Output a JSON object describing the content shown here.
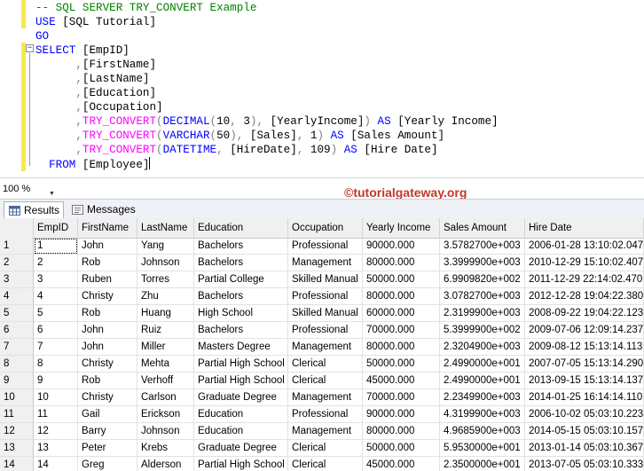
{
  "editor": {
    "lines": [
      [
        {
          "t": "-- SQL SERVER TRY_CONVERT Example",
          "c": "cm"
        }
      ],
      [
        {
          "t": "USE ",
          "c": "kw"
        },
        {
          "t": "[SQL Tutorial]",
          "c": "tx"
        }
      ],
      [
        {
          "t": "GO",
          "c": "kw"
        }
      ],
      [
        {
          "t": "SELECT ",
          "c": "kw"
        },
        {
          "t": "[EmpID]",
          "c": "tx"
        }
      ],
      [
        {
          "t": "      ,",
          "c": "gr"
        },
        {
          "t": "[FirstName]",
          "c": "tx"
        }
      ],
      [
        {
          "t": "      ,",
          "c": "gr"
        },
        {
          "t": "[LastName]",
          "c": "tx"
        }
      ],
      [
        {
          "t": "      ,",
          "c": "gr"
        },
        {
          "t": "[Education]",
          "c": "tx"
        }
      ],
      [
        {
          "t": "      ,",
          "c": "gr"
        },
        {
          "t": "[Occupation]",
          "c": "tx"
        }
      ],
      [
        {
          "t": "      ,",
          "c": "gr"
        },
        {
          "t": "TRY_CONVERT",
          "c": "fn"
        },
        {
          "t": "(",
          "c": "gr"
        },
        {
          "t": "DECIMAL",
          "c": "kw"
        },
        {
          "t": "(",
          "c": "gr"
        },
        {
          "t": "10",
          "c": "tx"
        },
        {
          "t": ", ",
          "c": "gr"
        },
        {
          "t": "3",
          "c": "tx"
        },
        {
          "t": "), ",
          "c": "gr"
        },
        {
          "t": "[YearlyIncome]",
          "c": "tx"
        },
        {
          "t": ") ",
          "c": "gr"
        },
        {
          "t": "AS ",
          "c": "kw"
        },
        {
          "t": "[Yearly Income]",
          "c": "tx"
        }
      ],
      [
        {
          "t": "      ,",
          "c": "gr"
        },
        {
          "t": "TRY_CONVERT",
          "c": "fn"
        },
        {
          "t": "(",
          "c": "gr"
        },
        {
          "t": "VARCHAR",
          "c": "kw"
        },
        {
          "t": "(",
          "c": "gr"
        },
        {
          "t": "50",
          "c": "tx"
        },
        {
          "t": "), ",
          "c": "gr"
        },
        {
          "t": "[Sales]",
          "c": "tx"
        },
        {
          "t": ", ",
          "c": "gr"
        },
        {
          "t": "1",
          "c": "tx"
        },
        {
          "t": ") ",
          "c": "gr"
        },
        {
          "t": "AS ",
          "c": "kw"
        },
        {
          "t": "[Sales Amount]",
          "c": "tx"
        }
      ],
      [
        {
          "t": "      ,",
          "c": "gr"
        },
        {
          "t": "TRY_CONVERT",
          "c": "fn"
        },
        {
          "t": "(",
          "c": "gr"
        },
        {
          "t": "DATETIME",
          "c": "kw"
        },
        {
          "t": ", ",
          "c": "gr"
        },
        {
          "t": "[HireDate]",
          "c": "tx"
        },
        {
          "t": ", ",
          "c": "gr"
        },
        {
          "t": "109",
          "c": "tx"
        },
        {
          "t": ") ",
          "c": "gr"
        },
        {
          "t": "AS ",
          "c": "kw"
        },
        {
          "t": "[Hire Date]",
          "c": "tx"
        }
      ],
      [
        {
          "t": "  FROM ",
          "c": "kw"
        },
        {
          "t": "[Employee]",
          "c": "tx"
        }
      ]
    ]
  },
  "zoom": {
    "value": "100 %"
  },
  "watermark": "©tutorialgateway.org",
  "tabs": [
    {
      "label": "Results",
      "icon": "results-grid-icon",
      "active": true
    },
    {
      "label": "Messages",
      "icon": "messages-icon",
      "active": false
    }
  ],
  "grid": {
    "columns": [
      "EmpID",
      "FirstName",
      "LastName",
      "Education",
      "Occupation",
      "Yearly Income",
      "Sales Amount",
      "Hire Date"
    ],
    "rows": [
      [
        "1",
        "1",
        "John",
        "Yang",
        "Bachelors",
        "Professional",
        "90000.000",
        "3.5782700e+003",
        "2006-01-28 13:10:02.047"
      ],
      [
        "2",
        "2",
        "Rob",
        "Johnson",
        "Bachelors",
        "Management",
        "80000.000",
        "3.3999900e+003",
        "2010-12-29 15:10:02.407"
      ],
      [
        "3",
        "3",
        "Ruben",
        "Torres",
        "Partial College",
        "Skilled Manual",
        "50000.000",
        "6.9909820e+002",
        "2011-12-29 22:14:02.470"
      ],
      [
        "4",
        "4",
        "Christy",
        "Zhu",
        "Bachelors",
        "Professional",
        "80000.000",
        "3.0782700e+003",
        "2012-12-28 19:04:22.380"
      ],
      [
        "5",
        "5",
        "Rob",
        "Huang",
        "High School",
        "Skilled Manual",
        "60000.000",
        "2.3199900e+003",
        "2008-09-22 19:04:22.123"
      ],
      [
        "6",
        "6",
        "John",
        "Ruiz",
        "Bachelors",
        "Professional",
        "70000.000",
        "5.3999900e+002",
        "2009-07-06 12:09:14.237"
      ],
      [
        "7",
        "7",
        "John",
        "Miller",
        "Masters Degree",
        "Management",
        "80000.000",
        "2.3204900e+003",
        "2009-08-12 15:13:14.113"
      ],
      [
        "8",
        "8",
        "Christy",
        "Mehta",
        "Partial High School",
        "Clerical",
        "50000.000",
        "2.4990000e+001",
        "2007-07-05 15:13:14.290"
      ],
      [
        "9",
        "9",
        "Rob",
        "Verhoff",
        "Partial High School",
        "Clerical",
        "45000.000",
        "2.4990000e+001",
        "2013-09-15 15:13:14.137"
      ],
      [
        "10",
        "10",
        "Christy",
        "Carlson",
        "Graduate Degree",
        "Management",
        "70000.000",
        "2.2349900e+003",
        "2014-01-25 16:14:14.110"
      ],
      [
        "11",
        "11",
        "Gail",
        "Erickson",
        "Education",
        "Professional",
        "90000.000",
        "4.3199900e+003",
        "2006-10-02 05:03:10.223"
      ],
      [
        "12",
        "12",
        "Barry",
        "Johnson",
        "Education",
        "Management",
        "80000.000",
        "4.9685900e+003",
        "2014-05-15 05:03:10.157"
      ],
      [
        "13",
        "13",
        "Peter",
        "Krebs",
        "Graduate Degree",
        "Clerical",
        "50000.000",
        "5.9530000e+001",
        "2013-01-14 05:03:10.367"
      ],
      [
        "14",
        "14",
        "Greg",
        "Alderson",
        "Partial High School",
        "Clerical",
        "45000.000",
        "2.3500000e+001",
        "2013-07-05 05:03:10.333"
      ]
    ]
  }
}
